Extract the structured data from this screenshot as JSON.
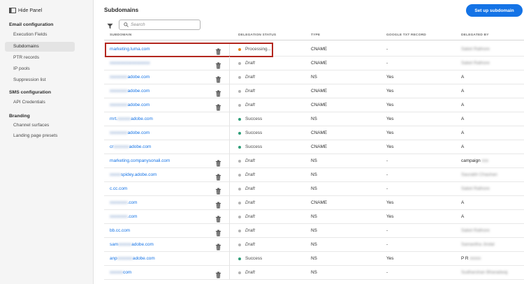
{
  "sidebar": {
    "hide_panel": "Hide Panel",
    "sections": [
      {
        "title": "Email configuration",
        "items": [
          "Execution Fields",
          "Subdomains",
          "PTR records",
          "IP pools",
          "Suppression list"
        ]
      },
      {
        "title": "SMS configuration",
        "items": [
          "API Credentials"
        ]
      },
      {
        "title": "Branding",
        "items": [
          "Channel surfaces",
          "Landing page presets"
        ]
      }
    ],
    "active_item": "Subdomains"
  },
  "header": {
    "title": "Subdomains",
    "setup_button": "Set up subdomain",
    "search_placeholder": "Search"
  },
  "table": {
    "columns": [
      "SUBDOMAIN",
      "DELEGATION STATUS",
      "TYPE",
      "GOOGLE TXT RECORD",
      "DELEGATED BY"
    ],
    "rows": [
      {
        "pre": "marketing.luma.com",
        "masked": "",
        "post": "",
        "status": "Processing...",
        "status_kind": "processing",
        "type": "CNAME",
        "txt": "-",
        "by": "",
        "by_masked": "Saket Rathore",
        "trash": true
      },
      {
        "pre": "",
        "masked": "xxxxxxxxxxxxxxxxxx",
        "post": "",
        "status": "Draft",
        "status_kind": "draft",
        "type": "CNAME",
        "txt": "-",
        "by": "",
        "by_masked": "Saket Rathore",
        "trash": true
      },
      {
        "pre": "",
        "masked": "xxxxxxxx",
        "post": "adobe.com",
        "status": "Draft",
        "status_kind": "draft",
        "type": "NS",
        "txt": "Yes",
        "by": "A",
        "by_masked": "",
        "trash": true
      },
      {
        "pre": "",
        "masked": "xxxxxxxx",
        "post": "adobe.com",
        "status": "Draft",
        "status_kind": "draft",
        "type": "CNAME",
        "txt": "Yes",
        "by": "A",
        "by_masked": "",
        "trash": true
      },
      {
        "pre": "",
        "masked": "xxxxxxxx",
        "post": "adobe.com",
        "status": "Draft",
        "status_kind": "draft",
        "type": "CNAME",
        "txt": "Yes",
        "by": "A",
        "by_masked": "",
        "trash": true
      },
      {
        "pre": "mrt.",
        "masked": "xxxxxx",
        "post": "adobe.com",
        "status": "Success",
        "status_kind": "success",
        "type": "NS",
        "txt": "Yes",
        "by": "A",
        "by_masked": "",
        "trash": false
      },
      {
        "pre": "",
        "masked": "xxxxxxxx",
        "post": "adobe.com",
        "status": "Success",
        "status_kind": "success",
        "type": "CNAME",
        "txt": "Yes",
        "by": "A",
        "by_masked": "",
        "trash": false
      },
      {
        "pre": "cr",
        "masked": "xxxxxxx",
        "post": "adobe.com",
        "status": "Success",
        "status_kind": "success",
        "type": "CNAME",
        "txt": "Yes",
        "by": "A",
        "by_masked": "",
        "trash": false
      },
      {
        "pre": "marketing.companysonali.com",
        "masked": "",
        "post": "",
        "status": "Draft",
        "status_kind": "draft",
        "type": "NS",
        "txt": "-",
        "by": "campaign",
        "by_masked": "xxx",
        "trash": true
      },
      {
        "pre": "",
        "masked": "xxxxx",
        "post": "spidey.adobe.com",
        "status": "Draft",
        "status_kind": "draft",
        "type": "NS",
        "txt": "-",
        "by": "",
        "by_masked": "Saurabh Chauhan",
        "trash": true
      },
      {
        "pre": "c.cc.com",
        "masked": "",
        "post": "",
        "status": "Draft",
        "status_kind": "draft",
        "type": "NS",
        "txt": "-",
        "by": "",
        "by_masked": "Saket Rathore",
        "trash": true
      },
      {
        "pre": "",
        "masked": "xxxxxxxx",
        "post": ".com",
        "status": "Draft",
        "status_kind": "draft",
        "type": "CNAME",
        "txt": "Yes",
        "by": "A",
        "by_masked": "",
        "trash": true
      },
      {
        "pre": "",
        "masked": "xxxxxxxx",
        "post": ".com",
        "status": "Draft",
        "status_kind": "draft",
        "type": "NS",
        "txt": "Yes",
        "by": "A",
        "by_masked": "",
        "trash": true
      },
      {
        "pre": "bb.cc.com",
        "masked": "",
        "post": "",
        "status": "Draft",
        "status_kind": "draft",
        "type": "NS",
        "txt": "-",
        "by": "",
        "by_masked": "Saket Rathore",
        "trash": true
      },
      {
        "pre": "sam",
        "masked": "xxxxxx",
        "post": "adobe.com",
        "status": "Draft",
        "status_kind": "draft",
        "type": "NS",
        "txt": "-",
        "by": "",
        "by_masked": "Samantha Jindal",
        "trash": true
      },
      {
        "pre": "anp",
        "masked": "xxxxxxx",
        "post": "adobe.com",
        "status": "Success",
        "status_kind": "success",
        "type": "NS",
        "txt": "Yes",
        "by": "P R",
        "by_masked": "xxxxx",
        "trash": false
      },
      {
        "pre": "",
        "masked": "xxxxxx",
        "post": "com",
        "status": "Draft",
        "status_kind": "draft",
        "type": "NS",
        "txt": "-",
        "by": "",
        "by_masked": "Sudharshan Bharadwaj",
        "trash": true
      }
    ]
  },
  "colors": {
    "accent": "#1473e6",
    "success": "#2d9d78",
    "processing": "#e68619",
    "draft": "#b3b3b3",
    "highlight": "#b3261e"
  },
  "icons": [
    "hide-panel-icon",
    "filter-icon",
    "search-icon",
    "trash-icon"
  ]
}
